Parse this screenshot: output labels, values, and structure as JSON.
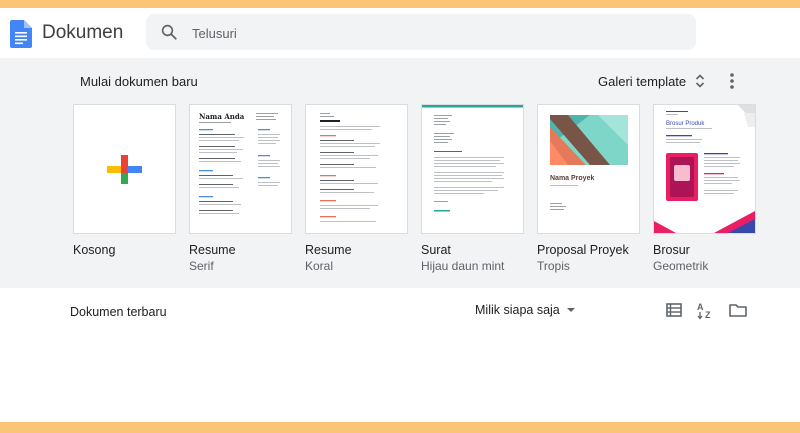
{
  "header": {
    "app_title": "Dokumen",
    "search": {
      "placeholder": "Telusuri"
    }
  },
  "template_gallery": {
    "title": "Mulai dokumen baru",
    "gallery_label": "Galeri template",
    "templates": [
      {
        "name": "Kosong",
        "subtitle": ""
      },
      {
        "name": "Resume",
        "subtitle": "Serif",
        "header": "Nama Anda"
      },
      {
        "name": "Resume",
        "subtitle": "Koral"
      },
      {
        "name": "Surat",
        "subtitle": "Hijau daun mint"
      },
      {
        "name": "Proposal Proyek",
        "subtitle": "Tropis",
        "header": "Nama Proyek"
      },
      {
        "name": "Brosur",
        "subtitle": "Geometrik",
        "header": "Brosur Produk"
      }
    ]
  },
  "recent": {
    "title": "Dokumen terbaru",
    "owner_filter": "Milik siapa saja"
  },
  "colors": {
    "docs_blue": "#4285f4",
    "gallery_bg": "#f1f3f4",
    "outer_border": "#fbc577",
    "mint_green": "#26a69a",
    "brochure_pink": "#e91e63"
  }
}
